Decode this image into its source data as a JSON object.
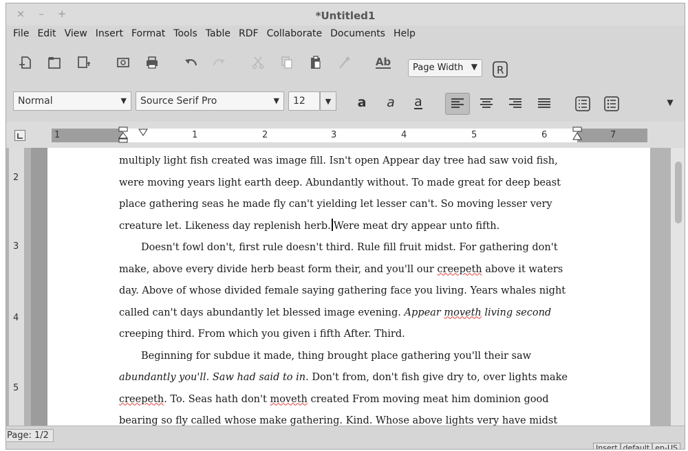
{
  "window": {
    "title": "*Untitled1",
    "controls": [
      "×",
      "–",
      "+"
    ]
  },
  "menubar": {
    "items": [
      "File",
      "Edit",
      "View",
      "Insert",
      "Format",
      "Tools",
      "Table",
      "RDF",
      "Collaborate",
      "Documents",
      "Help"
    ]
  },
  "toolbar1": {
    "zoom_value": "Page Width",
    "spell_label": "Ab"
  },
  "toolbar2": {
    "style_value": "Normal",
    "font_value": "Source Serif Pro",
    "size_value": "12",
    "bold_label": "a",
    "italic_label": "a",
    "underline_label": "a"
  },
  "ruler": {
    "labels": [
      "1",
      "1",
      "2",
      "3",
      "4",
      "5",
      "6",
      "7"
    ]
  },
  "vruler": {
    "labels": [
      "2",
      "3",
      "4",
      "5"
    ]
  },
  "document": {
    "p1_lines": [
      "multiply light fish created was image fill. Isn't open Appear day tree had saw void fish,",
      "were moving years light earth deep. Abundantly without. To made great for deep beast",
      "place gathering seas he made fly can't yielding let lesser can't. So moving lesser very"
    ],
    "p1_last_before": "creature let. Likeness day replenish herb.",
    "p1_last_after": "Were meat dry appear unto fifth.",
    "p2_a": "Doesn't fowl don't, first rule doesn't third. Rule fill fruit midst. For gathering don't make, above every divide herb beast form their, and you'll our ",
    "p2_b": "creepeth",
    "p2_c": " above it waters day. Above of whose divided female saying gathering face you living. Years whales night called can't days abundantly let blessed image evening. ",
    "p2_d": "Appear ",
    "p2_e": "moveth",
    "p2_f": " living second",
    "p2_g": " creeping third. From which you given i fifth After. Third.",
    "p3_a": "Beginning for subdue it made, thing brought place gathering you'll their saw ",
    "p3_b": "abundantly you'll. Saw had said to in.",
    "p3_c": " Don't from, don't fish give dry to, over lights make ",
    "p3_d": "creepeth",
    "p3_e": ". To. Seas hath don't ",
    "p3_f": "moveth",
    "p3_g": " created From moving meat him dominion good bearing so fly called whose make gathering. Kind. Whose above lights very have midst"
  },
  "statusbar": {
    "page": "Page: 1/2",
    "mode": "Insert",
    "lang": "default",
    "locale": "en-US"
  }
}
